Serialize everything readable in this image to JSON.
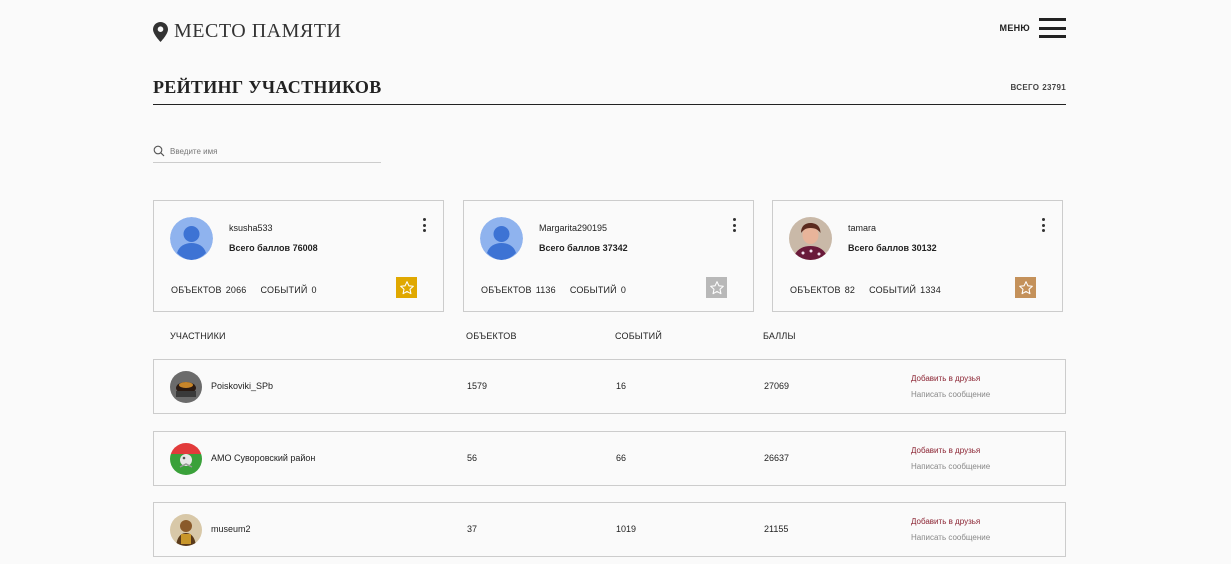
{
  "header": {
    "logo_text": "МЕСТО ПАМЯТИ",
    "menu_label": "МЕНЮ"
  },
  "page": {
    "title": "РЕЙТИНГ УЧАСТНИКОВ",
    "total_label": "ВСЕГО",
    "total_value": "23791"
  },
  "search": {
    "placeholder": "Введите имя",
    "value": ""
  },
  "top_cards": [
    {
      "name": "ksusha533",
      "score_label": "Всего баллов",
      "score": "76008",
      "objects_label": "ОБЪЕКТОВ",
      "objects": "2066",
      "events_label": "СОБЫТИЙ",
      "events": "0",
      "badge_color": "#e0a800",
      "avatar": "default"
    },
    {
      "name": "Margarita290195",
      "score_label": "Всего баллов",
      "score": "37342",
      "objects_label": "ОБЪЕКТОВ",
      "objects": "1136",
      "events_label": "СОБЫТИЙ",
      "events": "0",
      "badge_color": "#b8b8b8",
      "avatar": "default"
    },
    {
      "name": "tamara",
      "score_label": "Всего баллов",
      "score": "30132",
      "objects_label": "ОБЪЕКТОВ",
      "objects": "82",
      "events_label": "СОБЫТИЙ",
      "events": "1334",
      "badge_color": "#c4915a",
      "avatar": "photo"
    }
  ],
  "table": {
    "headers": {
      "participants": "УЧАСТНИКИ",
      "objects": "ОБЪЕКТОВ",
      "events": "СОБЫТИЙ",
      "points": "БАЛЛЫ"
    },
    "add_friend_label": "Добавить в друзья",
    "message_label": "Написать сообщение",
    "rows": [
      {
        "name": "Poiskoviki_SPb",
        "objects": "1579",
        "events": "16",
        "points": "27069"
      },
      {
        "name": "АМО Суворовский район",
        "objects": "56",
        "events": "66",
        "points": "26637"
      },
      {
        "name": "museum2",
        "objects": "37",
        "events": "1019",
        "points": "21155"
      }
    ]
  },
  "colors": {
    "accent_link": "#8b2332",
    "gold": "#e0a800",
    "silver": "#b8b8b8",
    "bronze": "#c4915a",
    "default_avatar": "#8fb3ee"
  },
  "icons": {
    "logo": "map-pin-icon",
    "menu": "hamburger-icon",
    "search": "search-icon",
    "more": "more-vertical-icon",
    "badge": "star-icon"
  }
}
